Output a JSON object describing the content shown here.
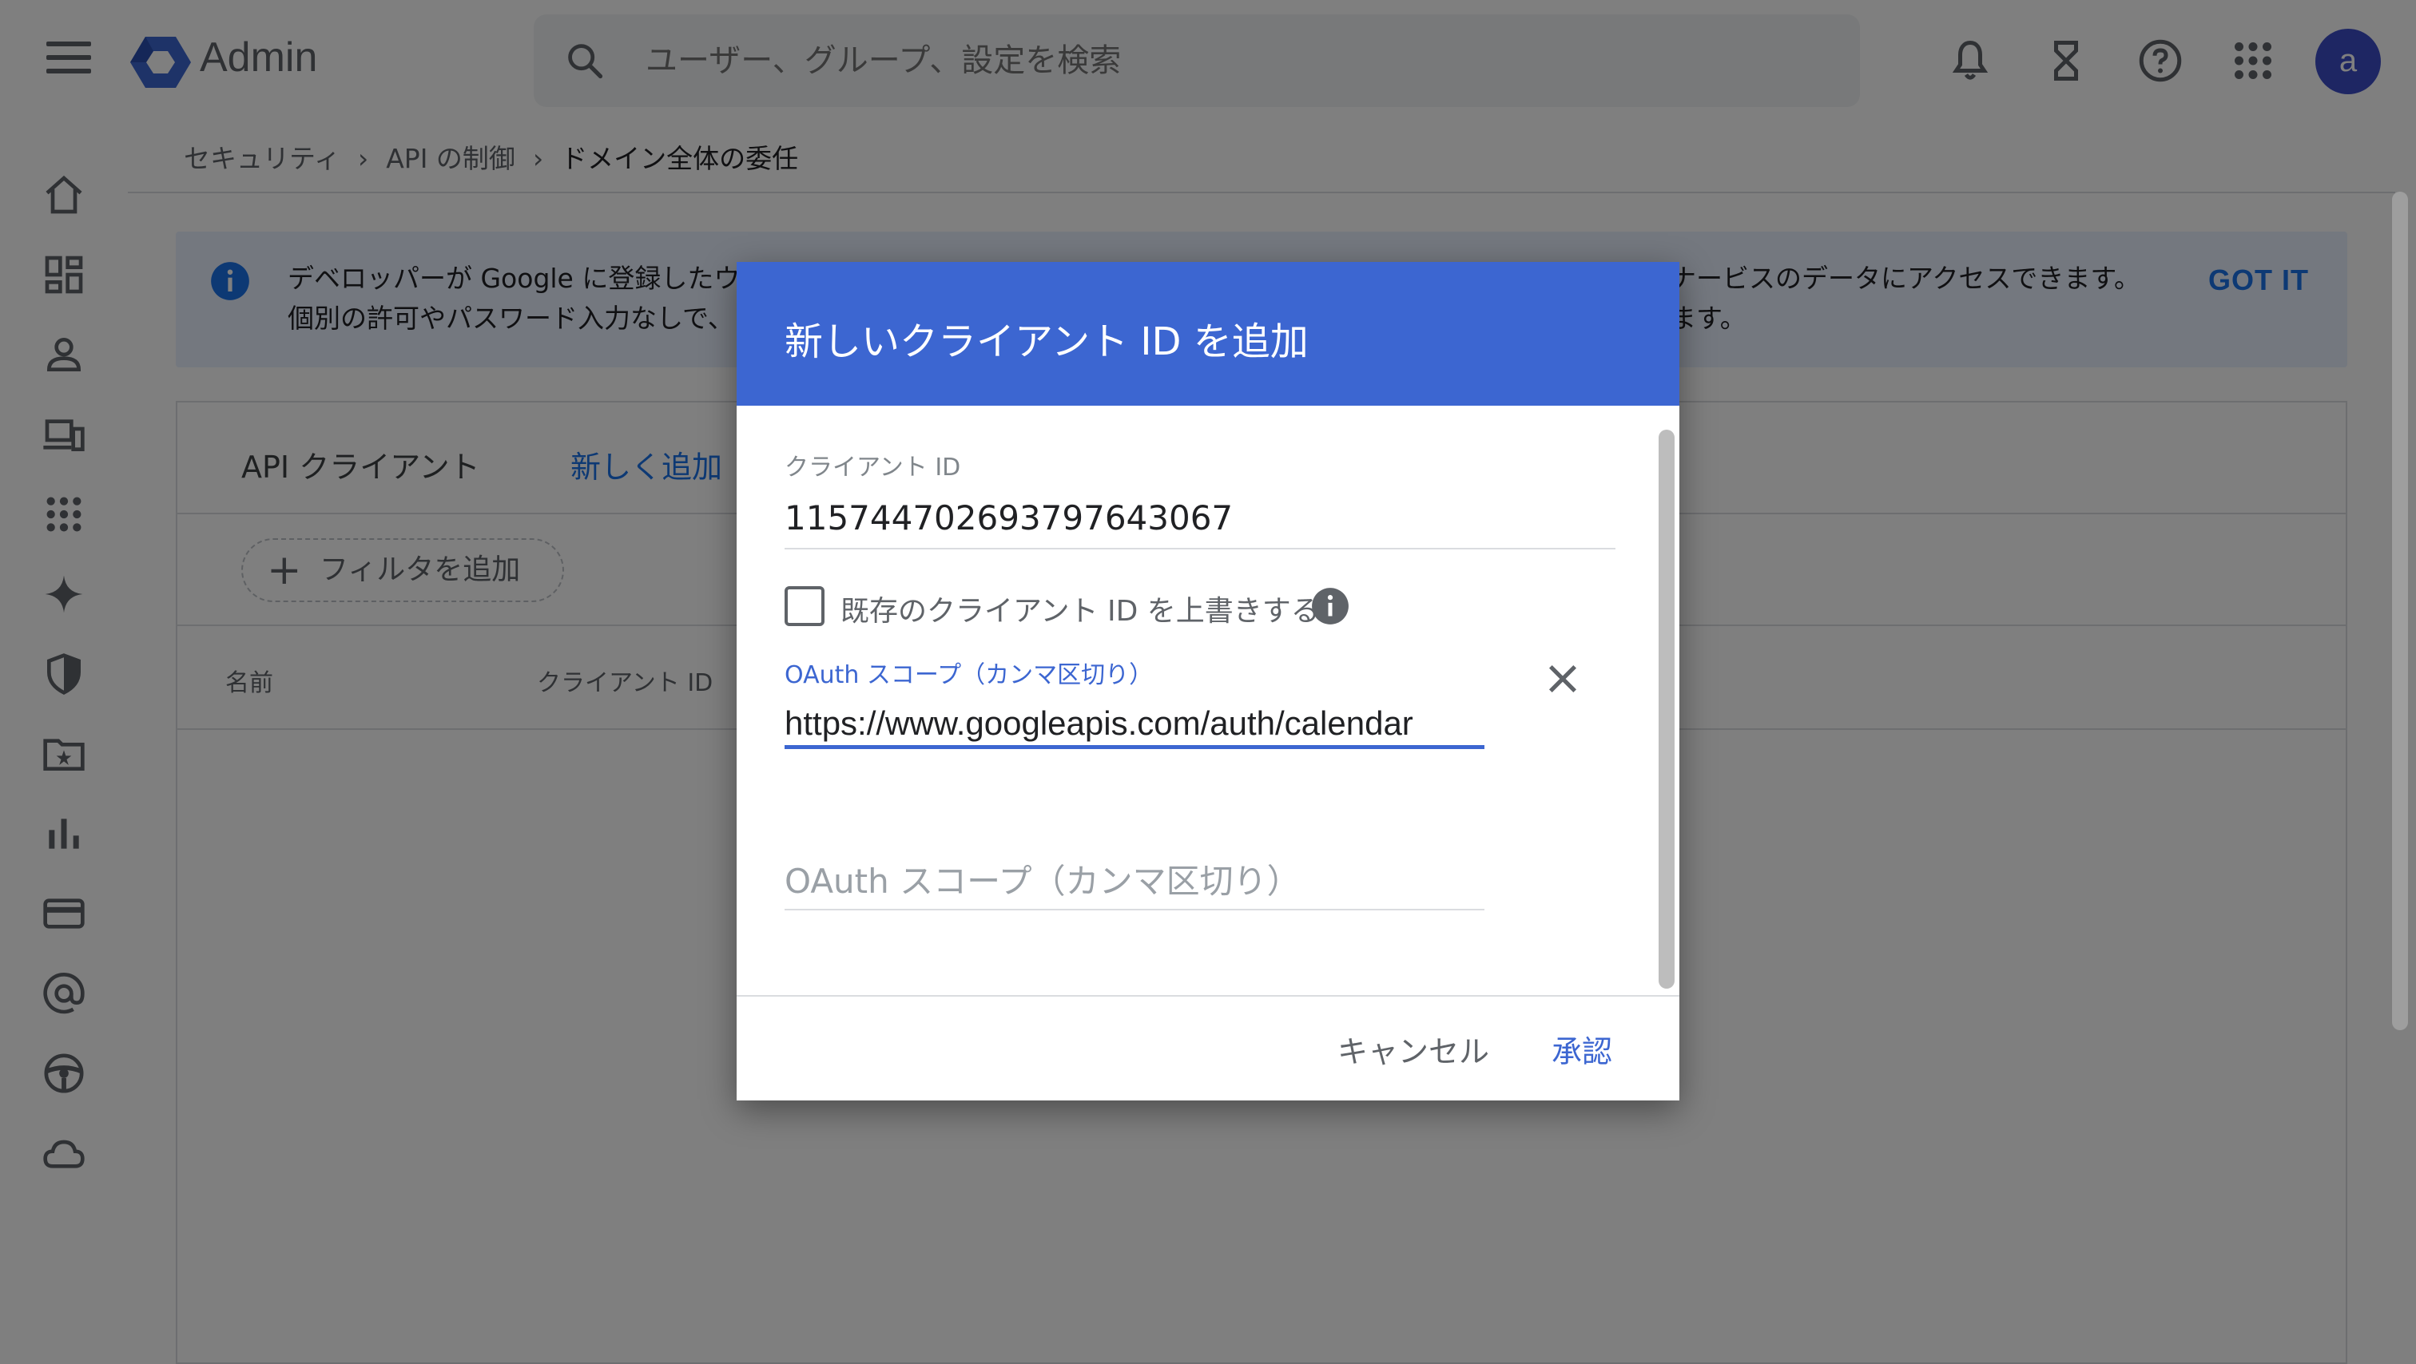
{
  "app": {
    "title": "Admin"
  },
  "search": {
    "placeholder": "ユーザー、グループ、設定を検索"
  },
  "topbar": {
    "icons": [
      "bell-icon",
      "hourglass-icon",
      "help-icon",
      "apps-grid-icon"
    ],
    "avatar_letter": "a"
  },
  "sidebar": {
    "icons": [
      "home-icon",
      "dashboard-icon",
      "user-icon",
      "devices-icon",
      "apps-icon",
      "sparkle-icon",
      "shield-icon",
      "folder-star-icon",
      "bar-chart-icon",
      "billing-card-icon",
      "at-sign-icon",
      "steering-wheel-icon",
      "cloud-icon"
    ]
  },
  "breadcrumb": {
    "items": [
      "セキュリティ",
      "API の制御",
      "ドメイン全体の委任"
    ],
    "separator": "›"
  },
  "banner": {
    "line1": "デベロッパーが Google に登録したウ",
    "line2": "個別の許可やパスワード入力なしで、",
    "line1_right": "ナービスのデータにアクセスできます。",
    "line2_right": "ます。",
    "action": "GOT IT"
  },
  "panel": {
    "title": "API クライアント",
    "add_new": "新しく追加",
    "filter_chip": "フィルタを追加",
    "columns": [
      "名前",
      "クライアント ID"
    ]
  },
  "dialog": {
    "title": "新しいクライアント ID を追加",
    "client_id_label": "クライアント ID",
    "client_id_value": "115744702693797643067",
    "overwrite_label": "既存のクライアント ID を上書きする",
    "overwrite_checked": false,
    "scope_label": "OAuth スコープ（カンマ区切り）",
    "scope_value": "https://www.googleapis.com/auth/calendar",
    "scope_placeholder": "OAuth スコープ（カンマ区切り）",
    "cancel": "キャンセル",
    "approve": "承認"
  },
  "colors": {
    "brand_blue": "#3c66d1",
    "link_blue": "#1a73e8",
    "avatar_bg": "#3c4cc7",
    "banner_bg": "#e8f0fe"
  }
}
